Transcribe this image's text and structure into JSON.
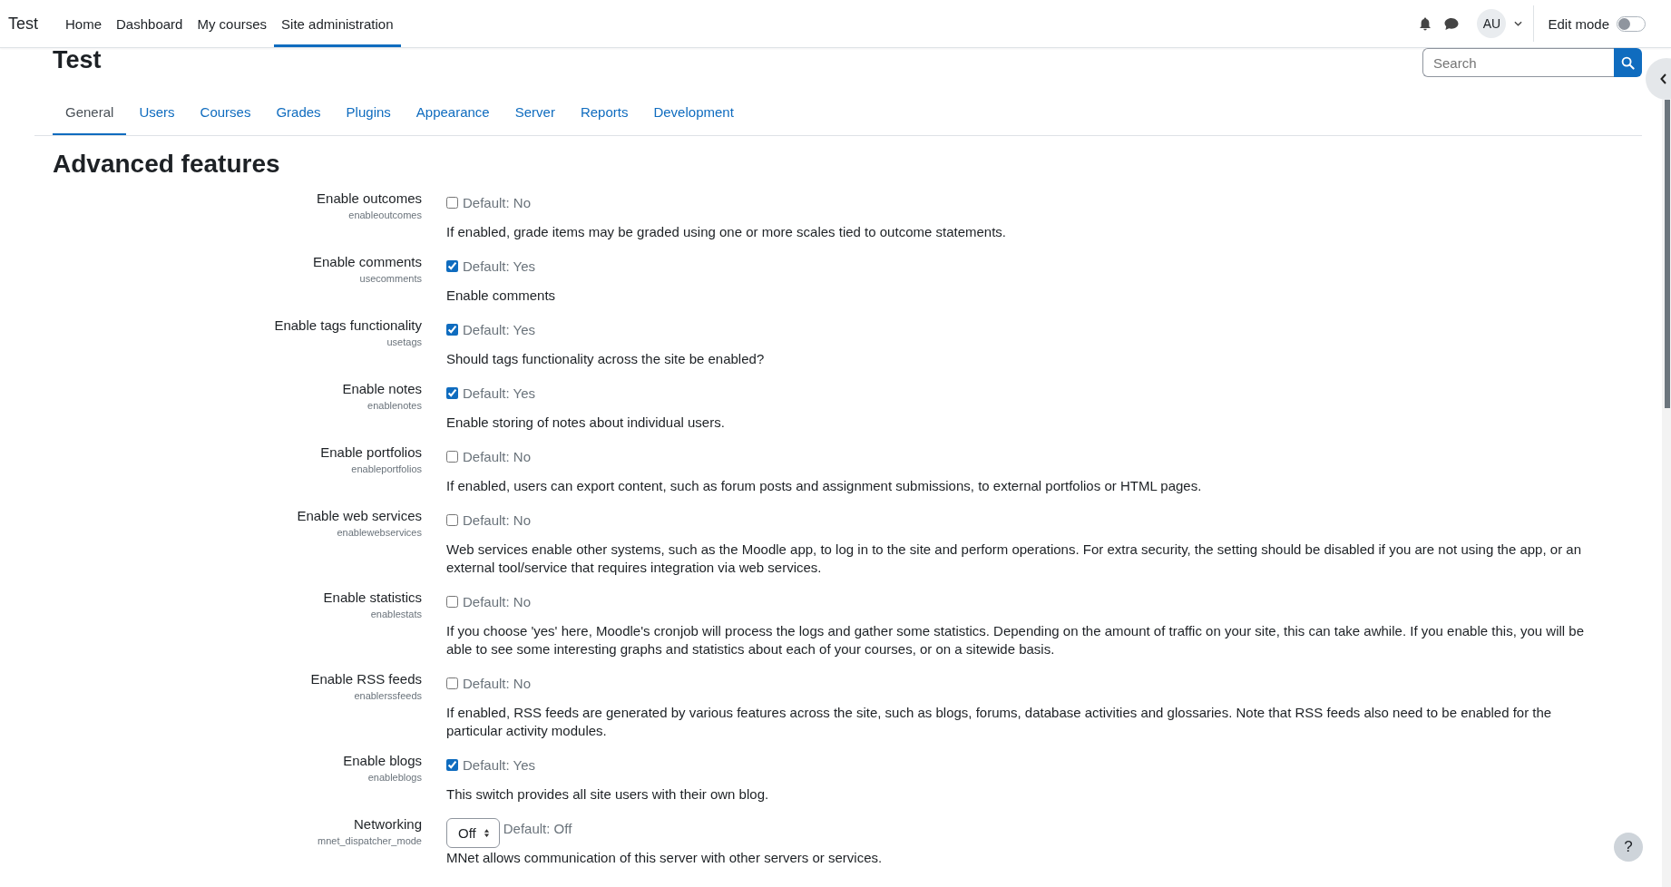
{
  "navbar": {
    "brand": "Test",
    "links": [
      {
        "label": "Home",
        "selected": false
      },
      {
        "label": "Dashboard",
        "selected": false
      },
      {
        "label": "My courses",
        "selected": false
      },
      {
        "label": "Site administration",
        "selected": true
      }
    ],
    "avatar": "AU",
    "edit_mode": {
      "label": "Edit mode",
      "on": false
    }
  },
  "page": {
    "title": "Test",
    "search": {
      "placeholder": "Search"
    }
  },
  "tabs": [
    {
      "label": "General",
      "selected": true
    },
    {
      "label": "Users",
      "selected": false
    },
    {
      "label": "Courses",
      "selected": false
    },
    {
      "label": "Grades",
      "selected": false
    },
    {
      "label": "Plugins",
      "selected": false
    },
    {
      "label": "Appearance",
      "selected": false
    },
    {
      "label": "Server",
      "selected": false
    },
    {
      "label": "Reports",
      "selected": false
    },
    {
      "label": "Development",
      "selected": false
    }
  ],
  "section_title": "Advanced features",
  "settings": [
    {
      "kind": "checkbox",
      "label": "Enable outcomes",
      "key": "enableoutcomes",
      "checked": false,
      "default": "Default: No",
      "description": "If enabled, grade items may be graded using one or more scales tied to outcome statements."
    },
    {
      "kind": "checkbox",
      "label": "Enable comments",
      "key": "usecomments",
      "checked": true,
      "default": "Default: Yes",
      "description": "Enable comments"
    },
    {
      "kind": "checkbox",
      "label": "Enable tags functionality",
      "key": "usetags",
      "checked": true,
      "default": "Default: Yes",
      "description": "Should tags functionality across the site be enabled?"
    },
    {
      "kind": "checkbox",
      "label": "Enable notes",
      "key": "enablenotes",
      "checked": true,
      "default": "Default: Yes",
      "description": "Enable storing of notes about individual users."
    },
    {
      "kind": "checkbox",
      "label": "Enable portfolios",
      "key": "enableportfolios",
      "checked": false,
      "default": "Default: No",
      "description": "If enabled, users can export content, such as forum posts and assignment submissions, to external portfolios or HTML pages."
    },
    {
      "kind": "checkbox",
      "label": "Enable web services",
      "key": "enablewebservices",
      "checked": false,
      "default": "Default: No",
      "description": "Web services enable other systems, such as the Moodle app, to log in to the site and perform operations. For extra security, the setting should be disabled if you are not using the app, or an external tool/service that requires integration via web services."
    },
    {
      "kind": "checkbox",
      "label": "Enable statistics",
      "key": "enablestats",
      "checked": false,
      "default": "Default: No",
      "description": "If you choose 'yes' here, Moodle's cronjob will process the logs and gather some statistics. Depending on the amount of traffic on your site, this can take awhile. If you enable this, you will be able to see some interesting graphs and statistics about each of your courses, or on a sitewide basis."
    },
    {
      "kind": "checkbox",
      "label": "Enable RSS feeds",
      "key": "enablerssfeeds",
      "checked": false,
      "default": "Default: No",
      "description": "If enabled, RSS feeds are generated by various features across the site, such as blogs, forums, database activities and glossaries. Note that RSS feeds also need to be enabled for the particular activity modules."
    },
    {
      "kind": "checkbox",
      "label": "Enable blogs",
      "key": "enableblogs",
      "checked": true,
      "default": "Default: Yes",
      "description": "This switch provides all site users with their own blog."
    },
    {
      "kind": "select",
      "label": "Networking",
      "key": "mnet_dispatcher_mode",
      "value": "Off",
      "default": "Default: Off",
      "description": "MNet allows communication of this server with other servers or services."
    }
  ],
  "help_button": "?"
}
